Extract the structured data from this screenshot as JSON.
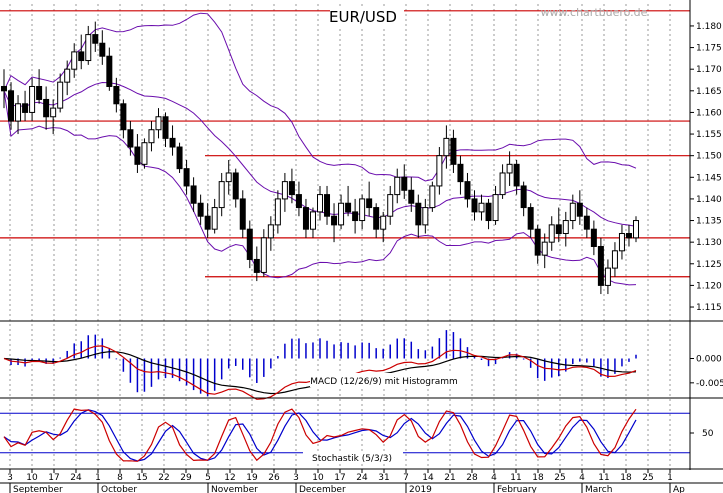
{
  "chart_data": {
    "type": "candlestick",
    "title": "EUR/USD",
    "watermark": "www.chartbuero.de",
    "price_panel": {
      "ylim": [
        1.112,
        1.186
      ],
      "yticks": [
        "1.180",
        "1.175",
        "1.170",
        "1.165",
        "1.160",
        "1.155",
        "1.150",
        "1.145",
        "1.140",
        "1.135",
        "1.130",
        "1.125",
        "1.120",
        "1.115"
      ],
      "horizontal_lines": [
        1.1835,
        1.158,
        1.15,
        1.131,
        1.122
      ],
      "candles": [
        [
          1.166,
          1.17,
          1.161,
          1.165
        ],
        [
          1.165,
          1.167,
          1.156,
          1.158
        ],
        [
          1.158,
          1.164,
          1.155,
          1.162
        ],
        [
          1.162,
          1.165,
          1.158,
          1.16
        ],
        [
          1.16,
          1.168,
          1.158,
          1.166
        ],
        [
          1.166,
          1.17,
          1.162,
          1.163
        ],
        [
          1.163,
          1.166,
          1.156,
          1.159
        ],
        [
          1.159,
          1.163,
          1.155,
          1.161
        ],
        [
          1.161,
          1.169,
          1.16,
          1.167
        ],
        [
          1.167,
          1.172,
          1.164,
          1.17
        ],
        [
          1.17,
          1.176,
          1.168,
          1.174
        ],
        [
          1.174,
          1.178,
          1.17,
          1.172
        ],
        [
          1.172,
          1.18,
          1.171,
          1.178
        ],
        [
          1.178,
          1.181,
          1.174,
          1.176
        ],
        [
          1.176,
          1.179,
          1.171,
          1.173
        ],
        [
          1.173,
          1.175,
          1.165,
          1.166
        ],
        [
          1.166,
          1.168,
          1.16,
          1.162
        ],
        [
          1.162,
          1.163,
          1.154,
          1.156
        ],
        [
          1.156,
          1.158,
          1.15,
          1.152
        ],
        [
          1.152,
          1.155,
          1.146,
          1.148
        ],
        [
          1.148,
          1.154,
          1.147,
          1.153
        ],
        [
          1.153,
          1.158,
          1.151,
          1.156
        ],
        [
          1.156,
          1.161,
          1.154,
          1.159
        ],
        [
          1.159,
          1.16,
          1.152,
          1.154
        ],
        [
          1.154,
          1.157,
          1.15,
          1.152
        ],
        [
          1.152,
          1.153,
          1.146,
          1.147
        ],
        [
          1.147,
          1.149,
          1.141,
          1.143
        ],
        [
          1.143,
          1.145,
          1.137,
          1.139
        ],
        [
          1.139,
          1.141,
          1.134,
          1.136
        ],
        [
          1.136,
          1.139,
          1.131,
          1.133
        ],
        [
          1.133,
          1.14,
          1.132,
          1.138
        ],
        [
          1.138,
          1.146,
          1.136,
          1.144
        ],
        [
          1.144,
          1.149,
          1.141,
          1.146
        ],
        [
          1.146,
          1.147,
          1.138,
          1.14
        ],
        [
          1.14,
          1.142,
          1.131,
          1.133
        ],
        [
          1.133,
          1.135,
          1.124,
          1.126
        ],
        [
          1.126,
          1.129,
          1.121,
          1.123
        ],
        [
          1.123,
          1.133,
          1.122,
          1.131
        ],
        [
          1.131,
          1.136,
          1.128,
          1.134
        ],
        [
          1.134,
          1.142,
          1.132,
          1.14
        ],
        [
          1.14,
          1.146,
          1.137,
          1.144
        ],
        [
          1.144,
          1.147,
          1.139,
          1.141
        ],
        [
          1.141,
          1.144,
          1.136,
          1.138
        ],
        [
          1.138,
          1.14,
          1.131,
          1.133
        ],
        [
          1.133,
          1.138,
          1.131,
          1.137
        ],
        [
          1.137,
          1.143,
          1.135,
          1.141
        ],
        [
          1.141,
          1.143,
          1.134,
          1.136
        ],
        [
          1.136,
          1.139,
          1.13,
          1.134
        ],
        [
          1.134,
          1.141,
          1.133,
          1.139
        ],
        [
          1.139,
          1.143,
          1.136,
          1.137
        ],
        [
          1.137,
          1.14,
          1.132,
          1.135
        ],
        [
          1.135,
          1.141,
          1.133,
          1.14
        ],
        [
          1.14,
          1.144,
          1.136,
          1.138
        ],
        [
          1.138,
          1.139,
          1.131,
          1.133
        ],
        [
          1.133,
          1.137,
          1.13,
          1.136
        ],
        [
          1.136,
          1.143,
          1.134,
          1.141
        ],
        [
          1.141,
          1.147,
          1.139,
          1.145
        ],
        [
          1.145,
          1.148,
          1.14,
          1.142
        ],
        [
          1.142,
          1.145,
          1.137,
          1.139
        ],
        [
          1.139,
          1.141,
          1.131,
          1.134
        ],
        [
          1.134,
          1.14,
          1.132,
          1.138
        ],
        [
          1.138,
          1.144,
          1.137,
          1.143
        ],
        [
          1.143,
          1.152,
          1.141,
          1.15
        ],
        [
          1.15,
          1.157,
          1.147,
          1.154
        ],
        [
          1.154,
          1.156,
          1.146,
          1.148
        ],
        [
          1.148,
          1.15,
          1.141,
          1.144
        ],
        [
          1.144,
          1.146,
          1.138,
          1.14
        ],
        [
          1.14,
          1.142,
          1.135,
          1.137
        ],
        [
          1.137,
          1.141,
          1.135,
          1.139
        ],
        [
          1.139,
          1.14,
          1.133,
          1.135
        ],
        [
          1.135,
          1.143,
          1.134,
          1.141
        ],
        [
          1.141,
          1.148,
          1.14,
          1.146
        ],
        [
          1.146,
          1.151,
          1.143,
          1.148
        ],
        [
          1.148,
          1.149,
          1.141,
          1.143
        ],
        [
          1.143,
          1.144,
          1.136,
          1.138
        ],
        [
          1.138,
          1.139,
          1.131,
          1.133
        ],
        [
          1.133,
          1.134,
          1.125,
          1.127
        ],
        [
          1.127,
          1.132,
          1.124,
          1.13
        ],
        [
          1.13,
          1.136,
          1.128,
          1.134
        ],
        [
          1.134,
          1.138,
          1.13,
          1.132
        ],
        [
          1.132,
          1.137,
          1.129,
          1.135
        ],
        [
          1.135,
          1.141,
          1.133,
          1.139
        ],
        [
          1.139,
          1.142,
          1.134,
          1.136
        ],
        [
          1.136,
          1.138,
          1.131,
          1.133
        ],
        [
          1.133,
          1.135,
          1.127,
          1.129
        ],
        [
          1.129,
          1.131,
          1.118,
          1.12
        ],
        [
          1.12,
          1.126,
          1.118,
          1.124
        ],
        [
          1.124,
          1.13,
          1.122,
          1.128
        ],
        [
          1.128,
          1.134,
          1.126,
          1.132
        ],
        [
          1.132,
          1.134,
          1.129,
          1.131
        ],
        [
          1.131,
          1.136,
          1.13,
          1.135
        ]
      ]
    },
    "macd_panel": {
      "label": "MACD (12/26/9) mit Histogramm",
      "ylim": [
        -0.0075,
        0.0075
      ],
      "yticks": [
        "0.000",
        "-0.005"
      ]
    },
    "stoch_panel": {
      "label": "Stochastik (5/3/3)",
      "ylim": [
        0,
        100
      ],
      "yticks": [
        "50"
      ],
      "bands": [
        80,
        20
      ]
    },
    "x_axis": {
      "day_labels": [
        "3",
        "10",
        "17",
        "24",
        "1",
        "8",
        "15",
        "22",
        "29",
        "5",
        "12",
        "19",
        "26",
        "3",
        "10",
        "17",
        "24",
        "31",
        "7",
        "14",
        "21",
        "28",
        "4",
        "11",
        "18",
        "25",
        "4",
        "11",
        "18",
        "25",
        "1"
      ],
      "month_labels": [
        {
          "text": "September",
          "tick": 0
        },
        {
          "text": "October",
          "tick": 4
        },
        {
          "text": "November",
          "tick": 9
        },
        {
          "text": "December",
          "tick": 13
        },
        {
          "text": "2019",
          "tick": 18
        },
        {
          "text": "February",
          "tick": 22
        },
        {
          "text": "March",
          "tick": 26
        },
        {
          "text": "Ap",
          "tick": 30
        }
      ]
    },
    "colors": {
      "candle": "#000000",
      "resistance": "#cc0000",
      "bollinger": "#6a0dad",
      "macd_signal": "#cc0000",
      "macd_line": "#000000",
      "histogram": "#0000cc",
      "stoch_k": "#cc0000",
      "stoch_d": "#0000cc",
      "grid": "#999999",
      "title_bg": "#ffffff"
    }
  }
}
